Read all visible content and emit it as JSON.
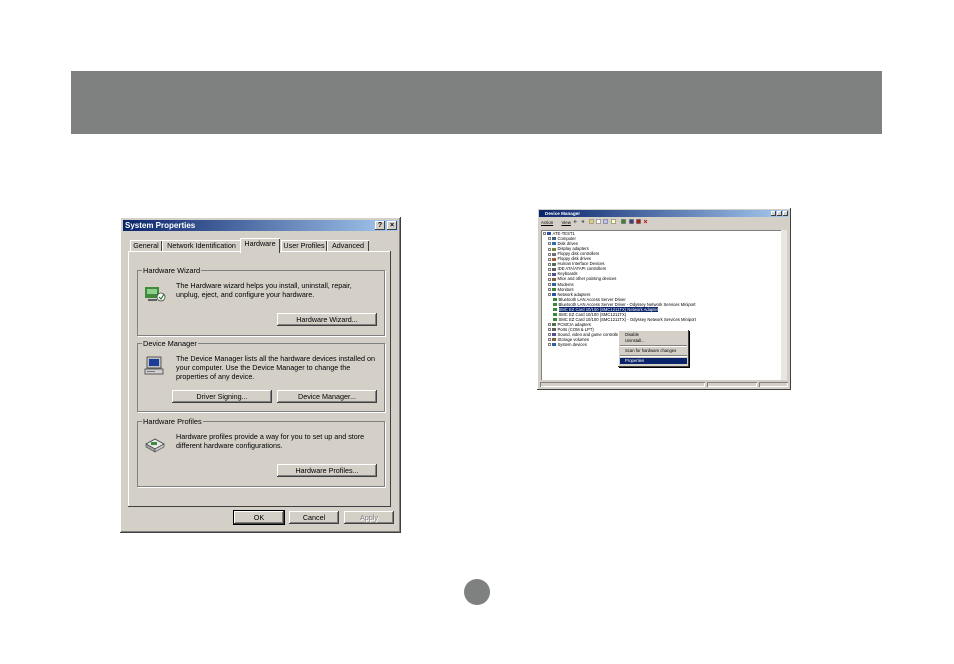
{
  "system_properties": {
    "title": "System Properties",
    "help_btn": "?",
    "close_btn": "×",
    "tabs": [
      "General",
      "Network Identification",
      "Hardware",
      "User Profiles",
      "Advanced"
    ],
    "active_tab": "Hardware",
    "hardware_wizard": {
      "label": "Hardware Wizard",
      "text": "The Hardware wizard helps you install, uninstall, repair, unplug, eject, and configure your hardware.",
      "button": "Hardware Wizard..."
    },
    "device_manager": {
      "label": "Device Manager",
      "text": "The Device Manager lists all the hardware devices installed on your computer. Use the Device Manager to change the properties of any device.",
      "driver_signing_button": "Driver Signing...",
      "device_manager_button": "Device Manager..."
    },
    "hardware_profiles": {
      "label": "Hardware Profiles",
      "text": "Hardware profiles provide a way for you to set up and store different hardware configurations.",
      "button": "Hardware Profiles..."
    },
    "ok": "OK",
    "cancel": "Cancel",
    "apply": "Apply"
  },
  "device_manager_window": {
    "title": "Device Manager",
    "menu": [
      "Action",
      "View"
    ],
    "tree": [
      {
        "label": "ATE-TEST1",
        "level": 0,
        "expanded": true
      },
      {
        "label": "Computer",
        "level": 1
      },
      {
        "label": "Disk drives",
        "level": 1
      },
      {
        "label": "Display adapters",
        "level": 1
      },
      {
        "label": "Floppy disk controllers",
        "level": 1
      },
      {
        "label": "Floppy disk drives",
        "level": 1
      },
      {
        "label": "Human Interface Devices",
        "level": 1
      },
      {
        "label": "IDE ATA/ATAPI controllers",
        "level": 1
      },
      {
        "label": "Keyboards",
        "level": 1
      },
      {
        "label": "Mice and other pointing devices",
        "level": 1
      },
      {
        "label": "Modems",
        "level": 1
      },
      {
        "label": "Monitors",
        "level": 1
      },
      {
        "label": "Network adapters",
        "level": 1,
        "expanded": true
      },
      {
        "label": "Bluetooth LAN Access Server Driver",
        "level": 2
      },
      {
        "label": "Bluetooth LAN Access Server Driver - Odyssey Network Services Miniport",
        "level": 2
      },
      {
        "label": "SMC EZ Card 10/100 (SMC1211TX) Network Adapter",
        "level": 2,
        "selected": true
      },
      {
        "label": "SMC EZ Card 10/100 (SMC1211TX)",
        "level": 2
      },
      {
        "label": "SMC EZ Card 10/100 (SMC1211TX) - Odyssey Network Services Miniport",
        "level": 2
      },
      {
        "label": "PCMCIA adapters",
        "level": 1
      },
      {
        "label": "Ports (COM & LPT)",
        "level": 1
      },
      {
        "label": "Sound, video and game controllers",
        "level": 1
      },
      {
        "label": "Storage volumes",
        "level": 1
      },
      {
        "label": "System devices",
        "level": 1
      }
    ],
    "context_menu": [
      "Disable",
      "Uninstall...",
      "Scan for hardware changes",
      "Properties"
    ]
  },
  "colors": {
    "banner": "#7f8080",
    "dialog_face": "#d4d0c8",
    "titlebar_start": "#0a246a",
    "titlebar_end": "#a6caf0"
  }
}
